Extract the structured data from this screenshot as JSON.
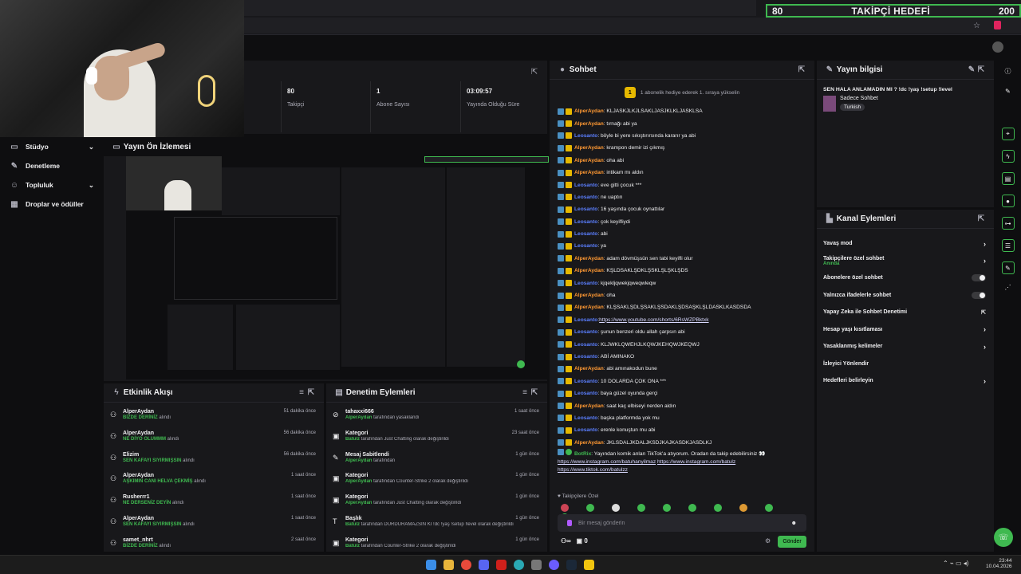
{
  "goal": {
    "current": "80",
    "title": "TAKİPÇİ HEDEFİ",
    "target": "200"
  },
  "stats": [
    {
      "value": "80",
      "label": "Takipçi"
    },
    {
      "value": "1",
      "label": "Abone Sayısı"
    },
    {
      "value": "03:09:57",
      "label": "Yayında Olduğu Süre"
    }
  ],
  "sidebar": [
    {
      "label": "Stüdyo"
    },
    {
      "label": "Denetleme"
    },
    {
      "label": "Topluluk"
    },
    {
      "label": "Droplar ve ödüller"
    }
  ],
  "preview": {
    "title": "Yayın Ön İzlemesi"
  },
  "chat": {
    "title": "Sohbet",
    "pinned": "1 abonelik hediye ederek 1. sıraya yükselin",
    "pinned_num": "1",
    "messages": [
      {
        "u": "AlperAydan",
        "c": "u1",
        "t": ": KLJASKJLKJLSAKLJASJKLKLJASKLSA"
      },
      {
        "u": "AlperAydan",
        "c": "u1",
        "t": ": tırnağı abi ya"
      },
      {
        "u": "Leosanto",
        "c": "u2",
        "t": ": böyle bi yere sıkıştırırsında kararır ya abi"
      },
      {
        "u": "AlperAydan",
        "c": "u1",
        "t": ": krampon demir izi çıkmış"
      },
      {
        "u": "AlperAydan",
        "c": "u1",
        "t": ": oha abi"
      },
      {
        "u": "AlperAydan",
        "c": "u1",
        "t": ": intikam mı aldın"
      },
      {
        "u": "Leosanto",
        "c": "u2",
        "t": ": eve gitti çocuk ***"
      },
      {
        "u": "Leosanto",
        "c": "u2",
        "t": ": ne uaptın"
      },
      {
        "u": "Leosanto",
        "c": "u2",
        "t": ": 16 yaşında çocuk oynattılar"
      },
      {
        "u": "Leosanto",
        "c": "u2",
        "t": ": çok keyifliydi"
      },
      {
        "u": "Leosanto",
        "c": "u2",
        "t": ": abi"
      },
      {
        "u": "Leosanto",
        "c": "u2",
        "t": ": ya"
      },
      {
        "u": "AlperAydan",
        "c": "u1",
        "t": ": adam dövmüşsün sen tabi keyifli olur"
      },
      {
        "u": "AlperAydan",
        "c": "u1",
        "t": ": KŞLDSAKLŞDKLŞSKLŞLŞKLŞDS"
      },
      {
        "u": "Leosanto",
        "c": "u2",
        "t": ": kjqekljqwekjqweqwleqw"
      },
      {
        "u": "AlperAydan",
        "c": "u1",
        "t": ": oha"
      },
      {
        "u": "AlperAydan",
        "c": "u1",
        "t": ": KLŞSAKLŞDLŞSAKLŞSDAKLŞDSAŞKLŞLDASKLKASDSDA"
      },
      {
        "u": "Leosanto",
        "c": "u2",
        "t": ": ",
        "l": "https://www.youtube.com/shorts/6RsWZPBktxk"
      },
      {
        "u": "Leosanto",
        "c": "u2",
        "t": ": şunun benzeri oldu allah çarpsın abi"
      },
      {
        "u": "Leosanto",
        "c": "u2",
        "t": ": KLJWKLQWEHJLKQWJKEHQWJKEQWJ"
      },
      {
        "u": "Leosanto",
        "c": "u2",
        "t": ": ABİ AMINAKO"
      },
      {
        "u": "AlperAydan",
        "c": "u1",
        "t": ": abi amınakodun bune"
      },
      {
        "u": "Leosanto",
        "c": "u2",
        "t": ": 10 DOLARDA ÇOK ONA ***"
      },
      {
        "u": "Leosanto",
        "c": "u2",
        "t": ": baya güzel oyunda gerçi"
      },
      {
        "u": "AlperAydan",
        "c": "u1",
        "t": ": saat kaç elbiseyi nerden aldın"
      },
      {
        "u": "Leosanto",
        "c": "u2",
        "t": ": başka platformda yok mu"
      },
      {
        "u": "Leosanto",
        "c": "u2",
        "t": ": erenle konuştun mu abi"
      },
      {
        "u": "AlperAydan",
        "c": "u1",
        "t": ": JKLSDALJKDALJKSDJKAJKASDKJASDLKJ"
      }
    ],
    "bot": {
      "u": "BotRix",
      "t": ": Yayından komik anları TikTok'a atıyorum. Oradan da takip edebilirsiniz 👀",
      "l1": "https://www.instagram.com/batuhanyilmaz",
      "l2": "https://www.instagram.com/batulz",
      "l3": "https://www.tiktok.com/batulzz"
    },
    "followers_label": "Takipçilere Özel",
    "input_placeholder": "Bir mesaj gönderin",
    "points": "0",
    "send": "Gönder"
  },
  "info": {
    "title": "Yayın bilgisi",
    "stream_title": "SEN HALA ANLAMADIN MI ? !dc !yaş !setup !level",
    "category": "Sadece Sohbet",
    "tag": "Turkish"
  },
  "actions": {
    "title": "Kanal Eylemleri",
    "items": [
      {
        "label": "Yavaş mod",
        "type": "arrow"
      },
      {
        "label": "Takipçilere özel sohbet",
        "sub": "Anında",
        "type": "arrow"
      },
      {
        "label": "Abonelere özel sohbet",
        "type": "toggle"
      },
      {
        "label": "Yalnızca ifadelerle sohbet",
        "type": "toggle"
      },
      {
        "label": "Yapay Zeka ile Sohbet Denetimi",
        "type": "ext"
      },
      {
        "label": "Hesap yaşı kısıtlaması",
        "type": "arrow"
      },
      {
        "label": "Yasaklanmış kelimeler",
        "type": "arrow"
      },
      {
        "label": "İzleyici Yönlendir",
        "type": "none"
      },
      {
        "label": "Hedefleri belirleyin",
        "type": "arrow"
      }
    ]
  },
  "activity": {
    "title": "Etkinlik Akışı",
    "items": [
      {
        "n": "AlperAydan",
        "g": "BİZDE DERİNİZ",
        "d": " alındı",
        "tm": "51 dakika önce"
      },
      {
        "n": "AlperAydan",
        "g": "NE DİYO OLUMMM",
        "d": " alındı",
        "tm": "56 dakika önce"
      },
      {
        "n": "Elizim",
        "g": "SEN KAFAYI SIYIRMIŞSIN",
        "d": " alındı",
        "tm": "56 dakika önce"
      },
      {
        "n": "AlperAydan",
        "g": "AŞKIMIN CANI HELVA ÇEKMİŞ",
        "d": " alındı",
        "tm": "1 saat önce"
      },
      {
        "n": "Rusherrr1",
        "g": "NE DERSENİZ DEYİN",
        "d": " alındı",
        "tm": "1 saat önce"
      },
      {
        "n": "AlperAydan",
        "g": "SEN KAFAYI SIYIRMIŞSIN",
        "d": " alındı",
        "tm": "1 saat önce"
      },
      {
        "n": "samet_nhrt",
        "g": "BİZDE DERİNİZ",
        "d": " alındı",
        "tm": "2 saat önce"
      }
    ]
  },
  "moderation": {
    "title": "Denetim Eylemleri",
    "items": [
      {
        "n": "tahaxxi666",
        "g": "AlperAydan",
        "d": " tarafından yasaklandı",
        "tm": "1 saat önce",
        "i": "⊘"
      },
      {
        "n": "Kategori",
        "g": "Batulz",
        "d": " tarafından Just Chatting olarak değiştirildi",
        "tm": "23 saat önce",
        "i": "▣"
      },
      {
        "n": "Mesaj Sabitlendi",
        "g": "AlperAydan",
        "d": " tarafından",
        "tm": "1 gün önce",
        "i": "✎"
      },
      {
        "n": "Kategori",
        "g": "AlperAydan",
        "d": " tarafından Counter-Strike 2 olarak değiştirildi",
        "tm": "1 gün önce",
        "i": "▣"
      },
      {
        "n": "Kategori",
        "g": "AlperAydan",
        "d": " tarafından Just Chatting olarak değiştirildi",
        "tm": "1 gün önce",
        "i": "▣"
      },
      {
        "n": "Başlık",
        "g": "Batulz",
        "d": " tarafından DURDURAMAZSIN Kİ !dc !yaş !setup !level olarak değiştirildi",
        "tm": "1 gün önce",
        "i": "T"
      },
      {
        "n": "Kategori",
        "g": "Batulz",
        "d": " tarafından Counter-Strike 2 olarak değiştirildi",
        "tm": "1 gün önce",
        "i": "▣"
      }
    ]
  },
  "clock": {
    "time": "23:44",
    "date": "10.04.2026"
  },
  "colors": {
    "accent": "#3fb950",
    "bg": "#0e0e10",
    "panel": "#18181b"
  }
}
